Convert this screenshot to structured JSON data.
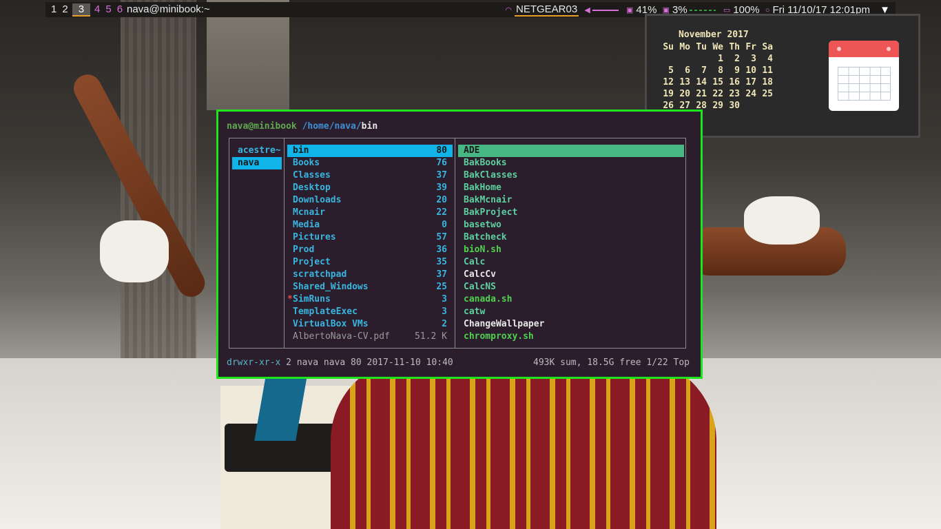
{
  "topbar": {
    "workspaces": [
      "1",
      "2",
      "3",
      "4",
      "5",
      "6"
    ],
    "active_workspace": "3",
    "window_title": "nava@minibook:~",
    "wifi": "NETGEAR03",
    "volume": "41%",
    "cpu": "3%",
    "battery": "100%",
    "datetime": "Fri 11/10/17 12:01pm"
  },
  "calendar": {
    "title": "November 2017",
    "weekdays": [
      "Su",
      "Mo",
      "Tu",
      "We",
      "Th",
      "Fr",
      "Sa"
    ],
    "weeks": [
      [
        "",
        "",
        "",
        "1",
        "2",
        "3",
        "4"
      ],
      [
        "5",
        "6",
        "7",
        "8",
        "9",
        "10",
        "11"
      ],
      [
        "12",
        "13",
        "14",
        "15",
        "16",
        "17",
        "18"
      ],
      [
        "19",
        "20",
        "21",
        "22",
        "23",
        "24",
        "25"
      ],
      [
        "26",
        "27",
        "28",
        "29",
        "30",
        "",
        ""
      ]
    ]
  },
  "terminal": {
    "user": "nava@minibook",
    "path_prefix": "/home/nava/",
    "path_leaf": "bin",
    "parent_entries": [
      "acestre~",
      "nava"
    ],
    "entries": [
      {
        "name": "bin",
        "count": "80"
      },
      {
        "name": "Books",
        "count": "76"
      },
      {
        "name": "Classes",
        "count": "37"
      },
      {
        "name": "Desktop",
        "count": "39"
      },
      {
        "name": "Downloads",
        "count": "20"
      },
      {
        "name": "Mcnair",
        "count": "22"
      },
      {
        "name": "Media",
        "count": "0"
      },
      {
        "name": "Pictures",
        "count": "57"
      },
      {
        "name": "Prod",
        "count": "36"
      },
      {
        "name": "Project",
        "count": "35"
      },
      {
        "name": "scratchpad",
        "count": "37"
      },
      {
        "name": "Shared_Windows",
        "count": "25"
      },
      {
        "name": "SimRuns",
        "count": "3",
        "mark": "*"
      },
      {
        "name": "TemplateExec",
        "count": "3"
      },
      {
        "name": "VirtualBox VMs",
        "count": "2"
      },
      {
        "name": "AlbertoNava-CV.pdf",
        "count": "51.2 K"
      }
    ],
    "preview": [
      "ADE",
      "BakBooks",
      "BakClasses",
      "BakHome",
      "BakMcnair",
      "BakProject",
      "basetwo",
      "Batcheck",
      "bioN.sh",
      "Calc",
      "CalcCv",
      "CalcNS",
      "canada.sh",
      "catw",
      "ChangeWallpaper",
      "chromproxy.sh"
    ],
    "status_perm": "drwxr-xr-x",
    "status_info": " 2 nava nava 80 2017-11-10 10:40",
    "status_right": "493K sum, 18.5G free  1/22  Top"
  }
}
